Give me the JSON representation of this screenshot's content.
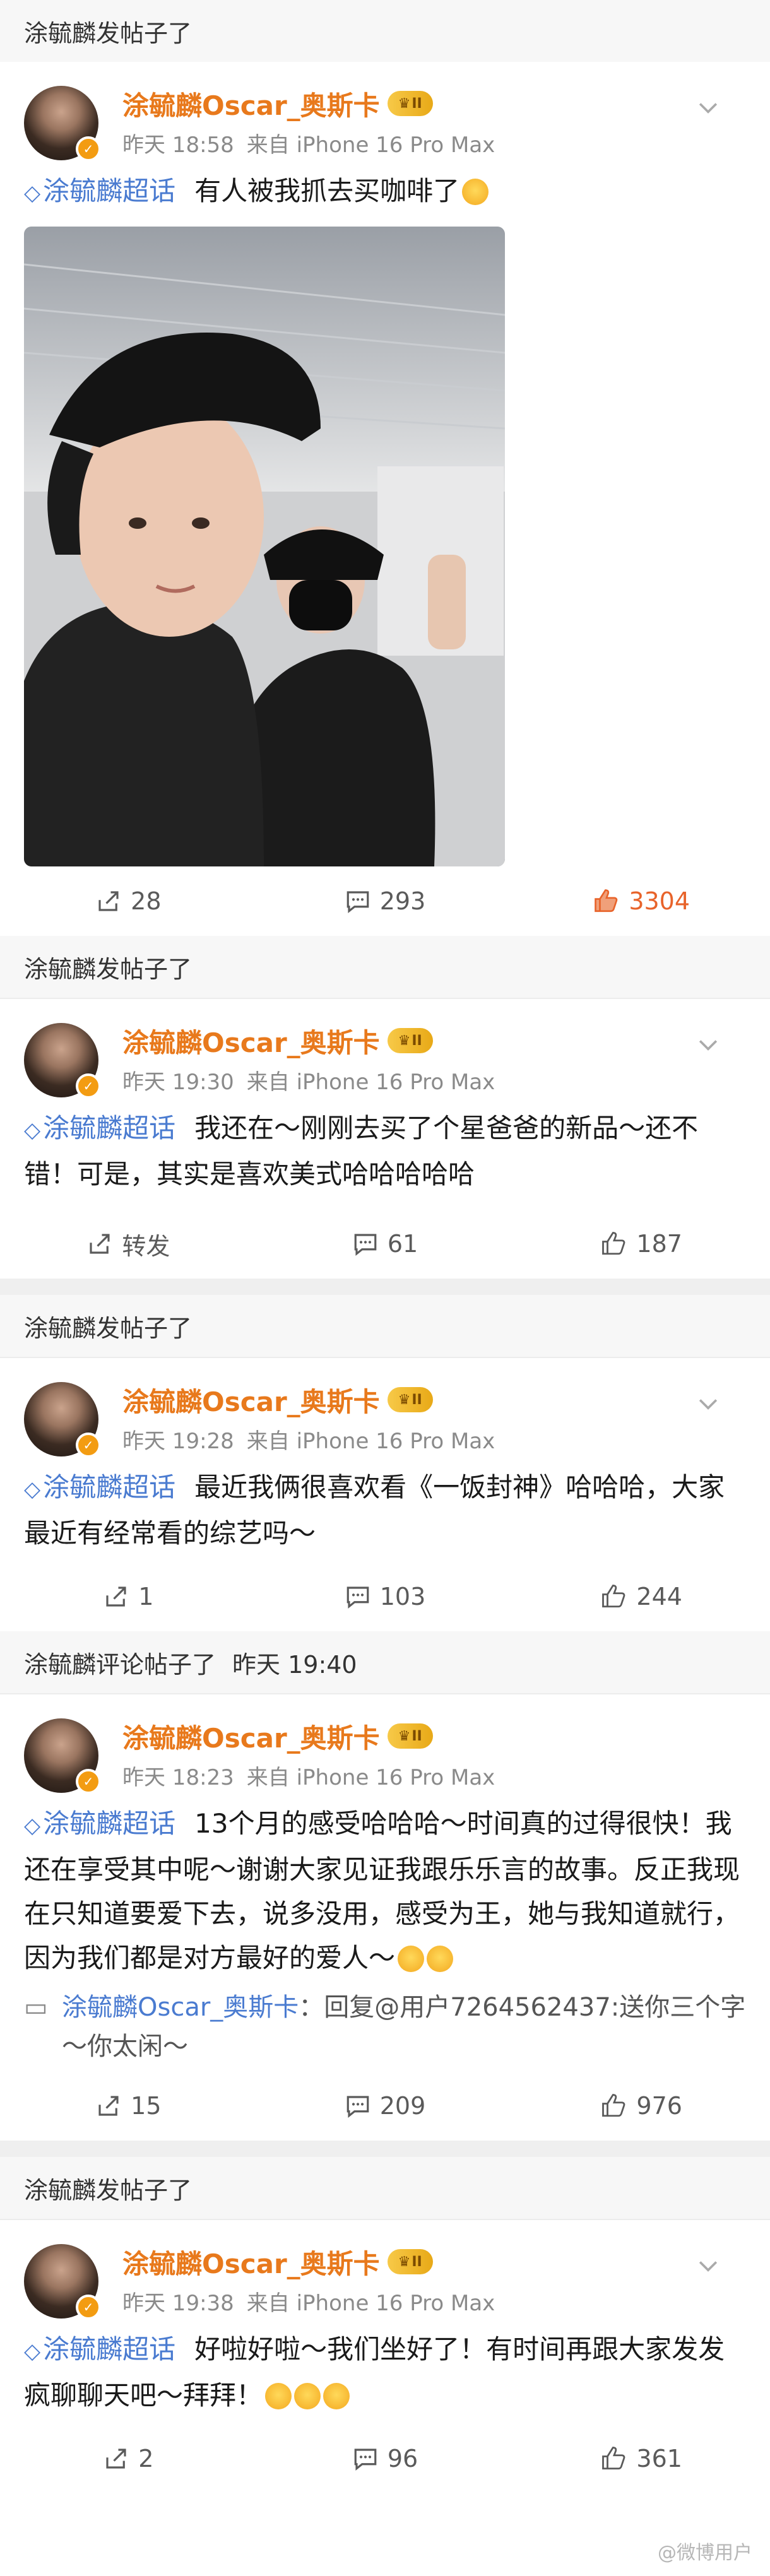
{
  "posts": [
    {
      "section": "涂毓麟发帖子了",
      "section_time": "",
      "author": "涂毓麟Oscar_奥斯卡",
      "vip_level": "II",
      "time": "昨天 18:58",
      "source": "来自 iPhone 16 Pro Max",
      "topic": "涂毓麟超话",
      "text": "有人被我抓去买咖啡了",
      "has_photo": true,
      "reply": null,
      "repost": "28",
      "comments": "293",
      "likes": "3304",
      "liked": true
    },
    {
      "section": "涂毓麟发帖子了",
      "section_time": "",
      "author": "涂毓麟Oscar_奥斯卡",
      "vip_level": "II",
      "time": "昨天 19:30",
      "source": "来自 iPhone 16 Pro Max",
      "topic": "涂毓麟超话",
      "text": "我还在～刚刚去买了个星爸爸的新品～还不错！可是，其实是喜欢美式哈哈哈哈哈",
      "has_photo": false,
      "reply": null,
      "repost": "转发",
      "comments": "61",
      "likes": "187",
      "liked": false
    },
    {
      "section": "涂毓麟发帖子了",
      "section_time": "",
      "author": "涂毓麟Oscar_奥斯卡",
      "vip_level": "II",
      "time": "昨天 19:28",
      "source": "来自 iPhone 16 Pro Max",
      "topic": "涂毓麟超话",
      "text": "最近我俩很喜欢看《一饭封神》哈哈哈，大家最近有经常看的综艺吗～",
      "has_photo": false,
      "reply": null,
      "repost": "1",
      "comments": "103",
      "likes": "244",
      "liked": false
    },
    {
      "section": "涂毓麟评论帖子了",
      "section_time": "昨天 19:40",
      "author": "涂毓麟Oscar_奥斯卡",
      "vip_level": "II",
      "time": "昨天 18:23",
      "source": "来自 iPhone 16 Pro Max",
      "topic": "涂毓麟超话",
      "text": "13个月的感受哈哈哈～时间真的过得很快！我还在享受其中呢～谢谢大家见证我跟乐乐言的故事。反正我现在只知道要爱下去，说多没用，感受为王，她与我知道就行，因为我们都是对方最好的爱人～",
      "has_photo": false,
      "reply": {
        "name": "涂毓麟Oscar_奥斯卡",
        "text": "：回复@用户7264562437:送你三个字～你太闲～"
      },
      "repost": "15",
      "comments": "209",
      "likes": "976",
      "liked": false
    },
    {
      "section": "涂毓麟发帖子了",
      "section_time": "",
      "author": "涂毓麟Oscar_奥斯卡",
      "vip_level": "II",
      "time": "昨天 19:38",
      "source": "来自 iPhone 16 Pro Max",
      "topic": "涂毓麟超话",
      "text": "好啦好啦～我们坐好了！有时间再跟大家发发疯聊聊天吧～拜拜！",
      "has_photo": false,
      "reply": null,
      "repost": "2",
      "comments": "96",
      "likes": "361",
      "liked": false
    }
  ],
  "watermark": "@微博用户",
  "colors": {
    "username": "#e8791c",
    "topic": "#4a7bd0",
    "liked": "#e8632a"
  }
}
